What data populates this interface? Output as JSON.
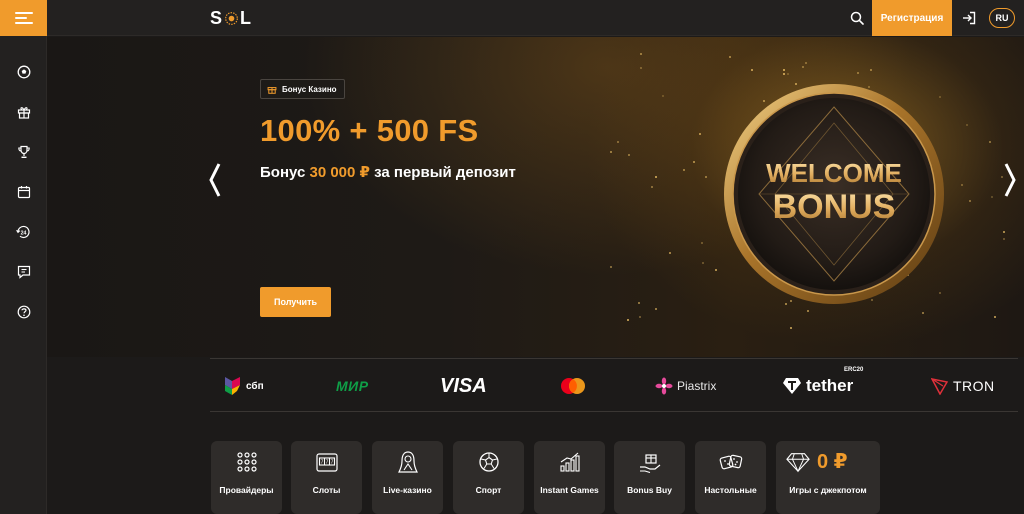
{
  "header": {
    "logo_text": "SOL",
    "register_label": "Регистрация",
    "lang_label": "RU",
    "icons": [
      "menu-icon",
      "search-icon",
      "login-icon"
    ]
  },
  "sidebar": {
    "items": [
      {
        "icon": "football-icon"
      },
      {
        "icon": "gift-icon"
      },
      {
        "icon": "trophy-icon"
      },
      {
        "icon": "calendar-icon"
      },
      {
        "icon": "support-24-icon"
      },
      {
        "icon": "chat-icon"
      },
      {
        "icon": "help-icon"
      }
    ]
  },
  "hero": {
    "badge_label": "Бонус Казино",
    "title": "100% + 500 FS",
    "subtitle_prefix": "Бонус ",
    "subtitle_amount": "30 000 ₽",
    "subtitle_suffix": " за первый депозит",
    "cta_label": "Получить",
    "coin_line1": "WELCOME",
    "coin_line2": "BONUS"
  },
  "payments": [
    {
      "name": "сбп",
      "icon": "sbp-icon"
    },
    {
      "name": "МИР",
      "icon": "mir-logo"
    },
    {
      "name": "VISA",
      "icon": "visa-logo"
    },
    {
      "name": "",
      "icon": "mastercard-logo"
    },
    {
      "name": "Piastrix",
      "icon": "piastrix-icon"
    },
    {
      "name": "tether",
      "extra": "ERC20",
      "icon": "tether-icon"
    },
    {
      "name": "TRON",
      "icon": "tron-icon"
    }
  ],
  "categories": [
    {
      "label": "Провайдеры",
      "icon": "providers-grid-icon"
    },
    {
      "label": "Слоты",
      "icon": "slot-machine-icon"
    },
    {
      "label": "Live-казино",
      "icon": "live-dealer-icon"
    },
    {
      "label": "Спорт",
      "icon": "soccer-ball-icon"
    },
    {
      "label": "Instant Games",
      "icon": "chart-bars-icon"
    },
    {
      "label": "Bonus Buy",
      "icon": "gift-hand-icon"
    },
    {
      "label": "Настольные",
      "icon": "dice-icon"
    },
    {
      "label": "Игры с джекпотом",
      "icon": "diamond-icon",
      "amount": "0 ₽"
    }
  ],
  "colors": {
    "accent": "#f09b2c",
    "background": "#1c1a19",
    "panel": "#232120",
    "card": "#2f2c2a"
  }
}
